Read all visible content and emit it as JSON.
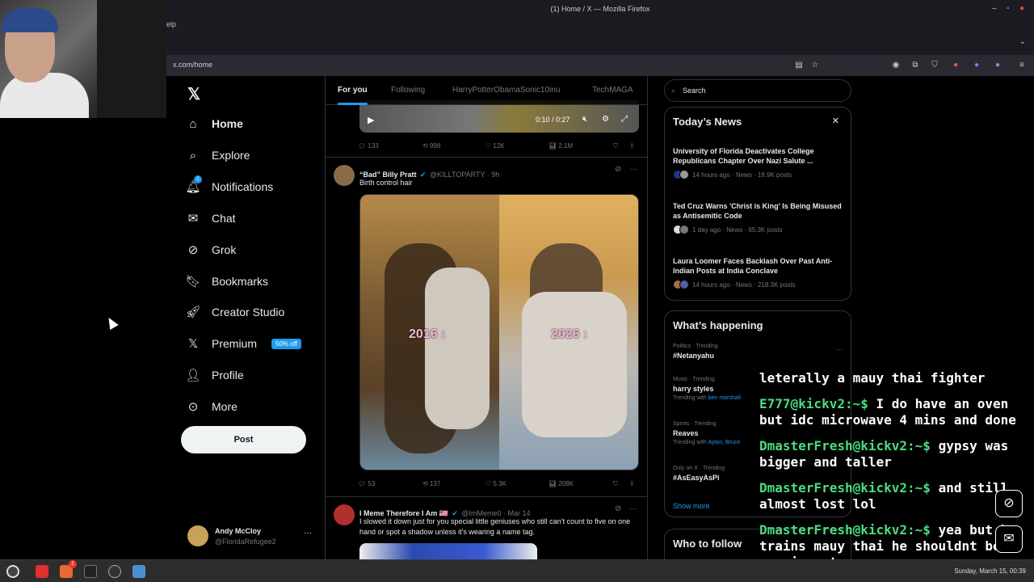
{
  "window": {
    "title": "(1) Home / X — Mozilla Firefox",
    "menu_fragment": "elp",
    "url": "x.com/home"
  },
  "sidebar": {
    "items": [
      {
        "label": "Home",
        "icon": "home-icon"
      },
      {
        "label": "Explore",
        "icon": "search-icon"
      },
      {
        "label": "Notifications",
        "icon": "bell-icon"
      },
      {
        "label": "Chat",
        "icon": "mail-icon"
      },
      {
        "label": "Grok",
        "icon": "grok-icon"
      },
      {
        "label": "Bookmarks",
        "icon": "bookmark-icon"
      },
      {
        "label": "Creator Studio",
        "icon": "rocket-icon"
      },
      {
        "label": "Premium",
        "icon": "x-logo-icon"
      },
      {
        "label": "Profile",
        "icon": "person-icon"
      },
      {
        "label": "More",
        "icon": "more-circle-icon"
      }
    ],
    "notifications_badge": "1",
    "premium_badge": "50% off",
    "post_label": "Post",
    "account": {
      "name": "Andy McCloy",
      "handle": "@FloridaRefugee2"
    }
  },
  "timeline": {
    "tabs": [
      "For you",
      "Following",
      "HarryPotterObamaSonic10inu",
      "TechMAGA"
    ],
    "video": {
      "time": "0:10 / 0:27"
    },
    "tweet0_stats": {
      "replies": "133",
      "reposts": "998",
      "likes": "12K",
      "views": "2.1M"
    },
    "tweet1": {
      "name": "“Bad” Billy Pratt",
      "handle": "@KILLTOPARTY · 9h",
      "text": "Birth control hair",
      "label_left": "2016 :",
      "label_right": "2026 :",
      "stats": {
        "replies": "53",
        "reposts": "137",
        "likes": "5.3K",
        "views": "208K"
      }
    },
    "tweet2": {
      "name": "I Meme Therefore I Am 🇺🇸",
      "handle": "@ImMeme0 · Mar 14",
      "text": "I slowed it down just for you special little geniuses who still can’t count to five on one hand or spot a shadow unless it’s wearing a name tag."
    }
  },
  "right": {
    "search_placeholder": "Search",
    "todays_news": {
      "title": "Today’s News",
      "items": [
        {
          "headline": "University of Florida Deactivates College Republicans Chapter Over Nazi Salute ...",
          "meta": "14 hours ago · News · 18.9K posts"
        },
        {
          "headline": "Ted Cruz Warns 'Christ is King' Is Being Misused as Antisemitic Code",
          "meta": "1 day ago · News · 65.3K posts"
        },
        {
          "headline": "Laura Loomer Faces Backlash Over Past Anti-Indian Posts at India Conclave",
          "meta": "14 hours ago · News · 218.3K posts"
        }
      ]
    },
    "whats_happening": {
      "title": "What’s happening",
      "trends": [
        {
          "category": "Politics · Trending",
          "name": "#Netanyahu",
          "sub_prefix": "",
          "sub_link": ""
        },
        {
          "category": "Music · Trending",
          "name": "harry styles",
          "sub_prefix": "Trending with",
          "sub_link": "ben marshall"
        },
        {
          "category": "Sports · Trending",
          "name": "Reaves",
          "sub_prefix": "Trending with",
          "sub_link": "Ayton, Bruce"
        },
        {
          "category": "Only on X · Trending",
          "name": "#AsEasyAsPi",
          "sub_prefix": "",
          "sub_link": ""
        }
      ],
      "show_more": "Show more"
    },
    "who_to_follow": "Who to follow"
  },
  "chat_overlay": [
    {
      "user": "",
      "text": "leterally a mauy thai fighter"
    },
    {
      "user": "E777@kickv2:~$",
      "text": "I do have an oven but idc microwave 4 mins and done"
    },
    {
      "user": "DmasterFresh@kickv2:~$",
      "text": "gypsy was bigger and taller"
    },
    {
      "user": "DmasterFresh@kickv2:~$",
      "text": "and still almost lost lol"
    },
    {
      "user": "DmasterFresh@kickv2:~$",
      "text": "yea but he trains mauy thai he shouldnt be gassin out"
    }
  ],
  "taskbar": {
    "clock": "Sunday, March 15, 00:39",
    "badge": "2"
  },
  "colors": {
    "accent": "#1d9bf0",
    "chat_user": "#4ade80",
    "bg": "#000000"
  }
}
